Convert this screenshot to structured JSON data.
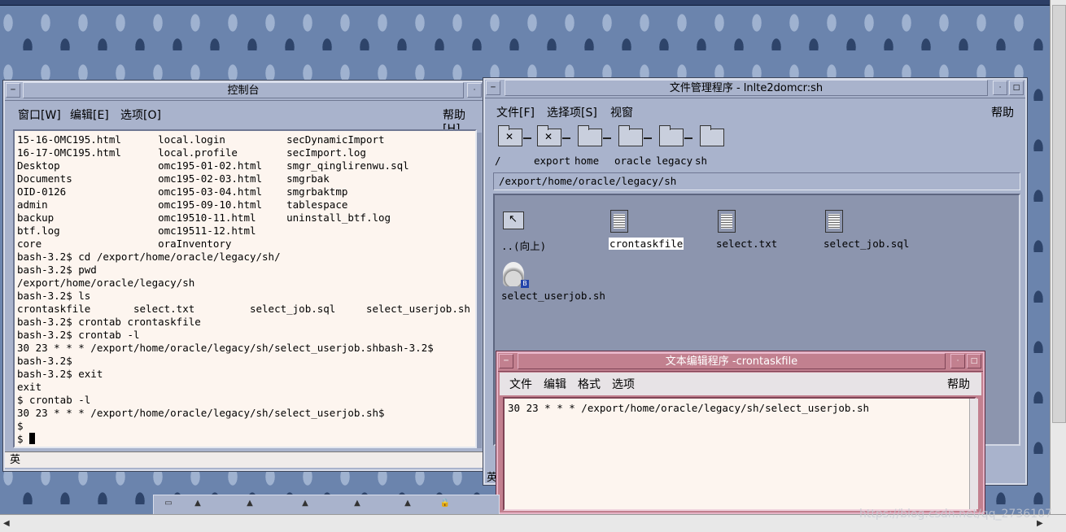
{
  "desktop": {
    "top_title": ""
  },
  "console": {
    "title": "控制台",
    "menu": {
      "window": "窗口[W]",
      "edit": "编辑[E]",
      "options": "选项[O]",
      "help": "帮助[H]"
    },
    "lines": [
      "15-16-OMC195.html      local.login          secDynamicImport",
      "16-17-OMC195.html      local.profile        secImport.log",
      "Desktop                omc195-01-02.html    smgr_qinglirenwu.sql",
      "Documents              omc195-02-03.html    smgrbak",
      "OID-0126               omc195-03-04.html    smgrbaktmp",
      "admin                  omc195-09-10.html    tablespace",
      "backup                 omc19510-11.html     uninstall_btf.log",
      "btf.log                omc19511-12.html",
      "core                   oraInventory",
      "bash-3.2$ cd /export/home/oracle/legacy/sh/",
      "bash-3.2$ pwd",
      "/export/home/oracle/legacy/sh",
      "bash-3.2$ ls",
      "crontaskfile       select.txt         select_job.sql     select_userjob.sh",
      "bash-3.2$ crontab crontaskfile",
      "bash-3.2$ crontab -l",
      "30 23 * * * /export/home/oracle/legacy/sh/select_userjob.shbash-3.2$",
      "bash-3.2$",
      "bash-3.2$ exit",
      "exit",
      "$ crontab -l",
      "30 23 * * * /export/home/oracle/legacy/sh/select_userjob.sh$",
      "$"
    ],
    "prompt": "$ ",
    "status": "英"
  },
  "filemanager": {
    "title": "文件管理程序 - lnlte2domcr:sh",
    "menu": {
      "file": "文件[F]",
      "select": "选择项[S]",
      "view": "视窗",
      "help": "帮助"
    },
    "crumbs": [
      "/",
      "export",
      "home",
      "oracle",
      "legacy",
      "sh"
    ],
    "path": "/export/home/oracle/legacy/sh",
    "files": [
      "..(向上)",
      "crontaskfile",
      "select.txt",
      "select_job.sql",
      "select_userjob.sh"
    ],
    "status": "英"
  },
  "editor": {
    "title": "文本编辑程序 -crontaskfile",
    "menu": {
      "file": "文件",
      "edit": "编辑",
      "format": "格式",
      "options": "选项",
      "help": "帮助"
    },
    "content": "30 23 * * * /export/home/oracle/legacy/sh/select_userjob.sh"
  },
  "watermark": "https://blog.csdn.net/qq_2736107"
}
